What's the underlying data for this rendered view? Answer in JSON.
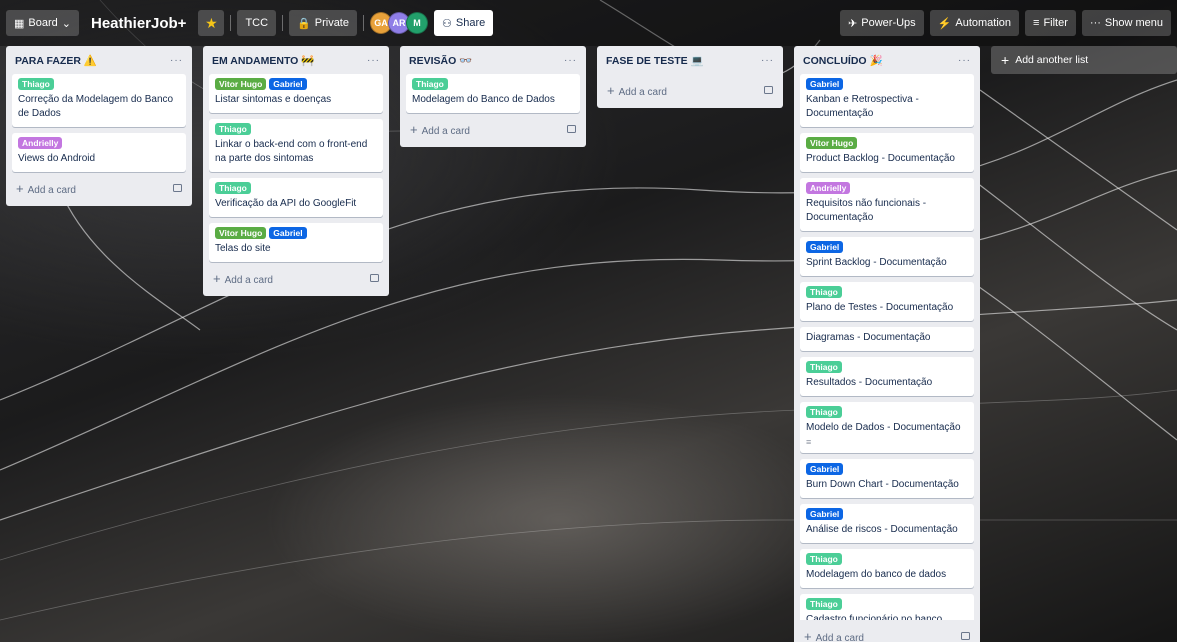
{
  "topbar": {
    "board_view": "Board",
    "board_title": "HeathierJob+",
    "workspace": "TCC",
    "visibility": "Private",
    "share": "Share",
    "avatars": [
      {
        "initials": "GA",
        "color": "#e8a13a"
      },
      {
        "initials": "AR",
        "color": "#8f7ee7"
      },
      {
        "initials": "M",
        "color": "#22a06b"
      }
    ],
    "power_ups": "Power-Ups",
    "automation": "Automation",
    "filter": "Filter",
    "show_menu": "Show menu"
  },
  "colors": {
    "label_thiago": "#4bce97",
    "label_vitor": "#5aac44",
    "label_gabriel": "#0c66e4",
    "label_andrielly": "#c377e0"
  },
  "lists": [
    {
      "title": "PARA FAZER ⚠️",
      "cards": [
        {
          "labels": [
            {
              "text": "Thiago",
              "color": "#4bce97"
            }
          ],
          "title": "Correção da Modelagem do Banco de Dados"
        },
        {
          "labels": [
            {
              "text": "Andrielly",
              "color": "#c377e0"
            }
          ],
          "title": "Views do Android"
        }
      ],
      "add_card": "Add a card"
    },
    {
      "title": "EM ANDAMENTO 🚧",
      "cards": [
        {
          "labels": [
            {
              "text": "Vitor Hugo",
              "color": "#5aac44"
            },
            {
              "text": "Gabriel",
              "color": "#0c66e4"
            }
          ],
          "title": "Listar sintomas e doenças"
        },
        {
          "labels": [
            {
              "text": "Thiago",
              "color": "#4bce97"
            }
          ],
          "title": "Linkar o back-end com o front-end na parte dos sintomas"
        },
        {
          "labels": [
            {
              "text": "Thiago",
              "color": "#4bce97"
            }
          ],
          "title": "Verificação da API do GoogleFit"
        },
        {
          "labels": [
            {
              "text": "Vitor Hugo",
              "color": "#5aac44"
            },
            {
              "text": "Gabriel",
              "color": "#0c66e4"
            }
          ],
          "title": "Telas do site"
        }
      ],
      "add_card": "Add a card"
    },
    {
      "title": "REVISÃO 👓",
      "cards": [
        {
          "labels": [
            {
              "text": "Thiago",
              "color": "#4bce97"
            }
          ],
          "title": "Modelagem do Banco de Dados"
        }
      ],
      "add_card": "Add a card"
    },
    {
      "title": "FASE DE TESTE 💻",
      "cards": [],
      "add_card": "Add a card"
    },
    {
      "title": "CONCLUÍDO 🎉",
      "cards": [
        {
          "labels": [
            {
              "text": "Gabriel",
              "color": "#0c66e4"
            }
          ],
          "title": "Kanban e Retrospectiva - Documentação"
        },
        {
          "labels": [
            {
              "text": "Vitor Hugo",
              "color": "#5aac44"
            }
          ],
          "title": "Product Backlog - Documentação"
        },
        {
          "labels": [
            {
              "text": "Andrielly",
              "color": "#c377e0"
            }
          ],
          "title": "Requisitos não funcionais - Documentação"
        },
        {
          "labels": [
            {
              "text": "Gabriel",
              "color": "#0c66e4"
            }
          ],
          "title": "Sprint Backlog - Documentação"
        },
        {
          "labels": [
            {
              "text": "Thiago",
              "color": "#4bce97"
            }
          ],
          "title": "Plano de Testes - Documentação"
        },
        {
          "labels": [],
          "title": "Diagramas - Documentação"
        },
        {
          "labels": [
            {
              "text": "Thiago",
              "color": "#4bce97"
            }
          ],
          "title": "Resultados - Documentação"
        },
        {
          "labels": [
            {
              "text": "Thiago",
              "color": "#4bce97"
            }
          ],
          "title": "Modelo de Dados - Documentação",
          "has_description": true
        },
        {
          "labels": [
            {
              "text": "Gabriel",
              "color": "#0c66e4"
            }
          ],
          "title": "Burn Down Chart - Documentação"
        },
        {
          "labels": [
            {
              "text": "Gabriel",
              "color": "#0c66e4"
            }
          ],
          "title": "Análise de riscos - Documentação"
        },
        {
          "labels": [
            {
              "text": "Thiago",
              "color": "#4bce97"
            }
          ],
          "title": "Modelagem do banco de dados"
        },
        {
          "labels": [
            {
              "text": "Thiago",
              "color": "#4bce97"
            }
          ],
          "title": "Cadastro funcionário no banco"
        }
      ],
      "add_card": "Add a card"
    }
  ],
  "add_list": "Add another list"
}
